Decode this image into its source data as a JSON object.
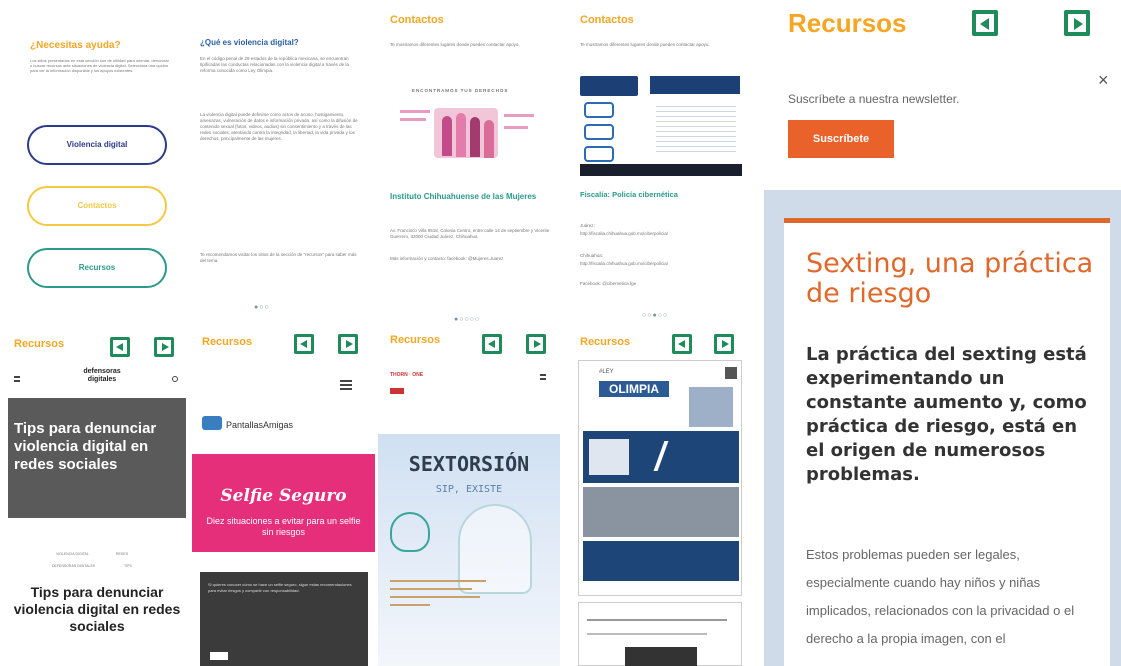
{
  "help": {
    "title": "¿Necesitas ayuda?",
    "body": "Los sitios presentados en esta sección son de utilidad para orientar, denunciar o buscar recursos ante situaciones de violencia digital. Selecciona una opción para ver la información disponible y los apoyos existentes.",
    "buttons": [
      "Violencia digital",
      "Contactos",
      "Recursos"
    ]
  },
  "vd": {
    "title": "¿Qué es violencia digital?",
    "p1": "En el código penal de 29 estados de la república mexicana, se encuentran tipificadas las conductas relacionadas con la violencia digital a través de la reforma conocida como Ley Olimpia.",
    "p2": "La violencia digital puede definirse como actos de acoso, hostigamiento, amenazas, vulneración de datos e información privada, así como la difusión de contenido sexual (fotos, videos, audios) sin consentimiento y a través de las redes sociales, atentando contra la integridad, la libertad, la vida privada y los derechos, principalmente de las mujeres.",
    "p3": "Te recomendamos visitar los sitios de la sección de \"recursos\" para saber más del tema.",
    "dots": "●○○"
  },
  "contactos1": {
    "title": "Contactos",
    "intro": "Te mostramos diferentes lugares donde puedes contactar apoyo.",
    "banner": "ENCONTRAMOS TUS DERECHOS",
    "org": "Instituto Chihuahuense de las Mujeres",
    "address": "Av. Francisco Villa 9518, Colonia Centro, entre calle 14 de septiembre y Vicente Guerrero, 32000 Ciudad Juárez, Chihuahua",
    "contact": "Más información y contacto: facebook: @Mujeres.Juarez",
    "dots": "●○○○○"
  },
  "contactos2": {
    "title": "Contactos",
    "intro": "Te mostramos diferentes lugares donde puedes contactar apoyo.",
    "org": "Fiscalía: Policía cibernética",
    "lines": [
      "Juárez:",
      "http://fiscalia.chihuahua.gob.mx/ciberpolicia/",
      "Chihuahua:",
      "http://fiscalia.chihuahua.gob.mx/ciberpolicia/",
      "Facebook: @cibernetica.fge"
    ],
    "dots": "○○●○○"
  },
  "recursos": {
    "title": "Recursos",
    "newsletter": "Suscríbete a nuestra newsletter.",
    "subscribe_label": "Suscríbete",
    "close_label": "×",
    "article_title": "Sexting, una práctica de riesgo",
    "article_lead": "La práctica del sexting está experimentando un constante aumento y, como práctica de riesgo, está en el origen de numerosos problemas.",
    "article_body": "Estos problemas pueden ser legales, especialmente cuando hay niños y niñas implicados, relacionados con la privacidad o el derecho a la propia imagen, con el"
  },
  "res1": {
    "title": "Recursos",
    "logo": "defensoras digitales",
    "hero": "Tips para denunciar violencia digital en redes sociales",
    "tags": [
      "VIOLENCIA DIGITAL",
      "REDES",
      "DEFENSORAS DIGITALES",
      "TIPS"
    ],
    "heading": "Tips para denunciar violencia digital en redes sociales"
  },
  "res2": {
    "title": "Recursos",
    "brand": "PantallasAmigas",
    "selfie_title": "Selfie Seguro",
    "selfie_sub": "Diez situaciones a evitar para un selfie sin riesgos",
    "dark_text": "Si quieres conocer cómo se hace un selfie seguro, sigue estas recomendaciones para evitar riesgos y compartir con responsabilidad."
  },
  "res3": {
    "title": "Recursos",
    "logo": "THORN · ONE",
    "title_art": "SEXTORSIÓN",
    "subtitle_art": "SIP, EXISTE"
  },
  "res4": {
    "title": "Recursos",
    "tag": "#LEY",
    "name": "OLIMPIA"
  },
  "colors": {
    "orange": "#f5a623",
    "green": "#1f8a5a",
    "navy": "#2b3a8c",
    "teal": "#2a9a8a",
    "sexting_orange": "#e0682b",
    "subscribe_bg": "#e8622a"
  }
}
